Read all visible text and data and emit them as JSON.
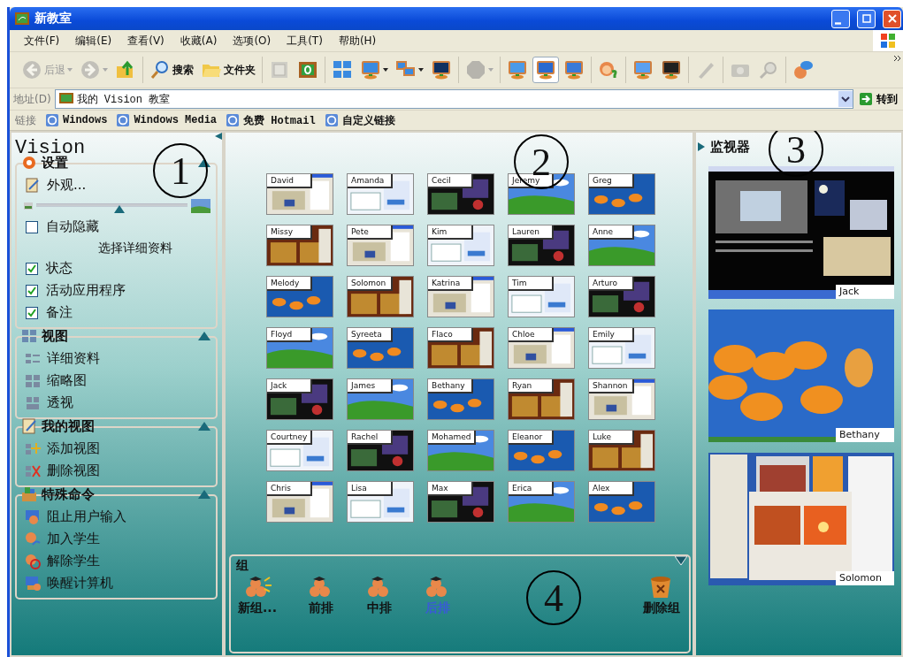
{
  "window": {
    "title": "新教室"
  },
  "menu": [
    {
      "label": "文件(F)"
    },
    {
      "label": "编辑(E)"
    },
    {
      "label": "查看(V)"
    },
    {
      "label": "收藏(A)"
    },
    {
      "label": "选项(O)"
    },
    {
      "label": "工具(T)"
    },
    {
      "label": "帮助(H)"
    }
  ],
  "toolbar": [
    {
      "kind": "button",
      "label": "后退",
      "disabled": true,
      "dropdown": true,
      "selected": false
    },
    {
      "kind": "button",
      "disabled": true,
      "dropdown": true,
      "selected": false
    },
    {
      "kind": "button",
      "disabled": false,
      "dropdown": false,
      "selected": false
    },
    {
      "kind": "separator"
    },
    {
      "kind": "button",
      "label": "搜索",
      "disabled": false,
      "dropdown": false,
      "selected": false
    },
    {
      "kind": "button",
      "label": "文件夹",
      "disabled": false,
      "dropdown": false,
      "selected": false
    },
    {
      "kind": "separator"
    },
    {
      "kind": "button",
      "disabled": true,
      "dropdown": false,
      "selected": false
    },
    {
      "kind": "button",
      "disabled": false,
      "dropdown": false,
      "selected": false
    },
    {
      "kind": "separator"
    },
    {
      "kind": "button",
      "disabled": false,
      "dropdown": false,
      "selected": false
    },
    {
      "kind": "button",
      "disabled": false,
      "dropdown": true,
      "selected": false
    },
    {
      "kind": "button",
      "disabled": false,
      "dropdown": true,
      "selected": false
    },
    {
      "kind": "button",
      "disabled": false,
      "dropdown": false,
      "selected": false
    },
    {
      "kind": "separator"
    },
    {
      "kind": "button",
      "disabled": true,
      "dropdown": true,
      "selected": false
    },
    {
      "kind": "separator"
    },
    {
      "kind": "button",
      "disabled": false,
      "dropdown": false,
      "selected": false
    },
    {
      "kind": "button",
      "disabled": false,
      "dropdown": false,
      "selected": true
    },
    {
      "kind": "button",
      "disabled": false,
      "dropdown": false,
      "selected": false
    },
    {
      "kind": "separator"
    },
    {
      "kind": "button",
      "disabled": false,
      "dropdown": false,
      "selected": false
    },
    {
      "kind": "separator"
    },
    {
      "kind": "button",
      "disabled": false,
      "dropdown": false,
      "selected": false
    },
    {
      "kind": "button",
      "disabled": false,
      "dropdown": false,
      "selected": false
    },
    {
      "kind": "separator"
    },
    {
      "kind": "button",
      "disabled": true,
      "dropdown": false,
      "selected": false
    },
    {
      "kind": "separator"
    },
    {
      "kind": "button",
      "disabled": true,
      "dropdown": false,
      "selected": false
    },
    {
      "kind": "button",
      "disabled": true,
      "dropdown": false,
      "selected": false
    },
    {
      "kind": "separator"
    },
    {
      "kind": "button",
      "disabled": false,
      "dropdown": false,
      "selected": false
    }
  ],
  "address": {
    "label": "地址(D)",
    "value": "我的 Vision 教室",
    "go": "转到"
  },
  "links": {
    "label": "链接",
    "items": [
      {
        "label": "Windows"
      },
      {
        "label": "Windows Media"
      },
      {
        "label": "免费 Hotmail"
      },
      {
        "label": "自定义链接"
      }
    ]
  },
  "sidebar": {
    "title": "Vision",
    "callout": "1",
    "sections": [
      {
        "title": "设置",
        "items": [
          {
            "kind": "link",
            "label": "外观..."
          },
          {
            "kind": "slider",
            "level": 0.55
          },
          {
            "kind": "checkbox",
            "label": "自动隐藏",
            "checked": false
          },
          {
            "kind": "heading",
            "label": "选择详细资料"
          },
          {
            "kind": "checkbox",
            "label": "状态",
            "checked": true
          },
          {
            "kind": "checkbox",
            "label": "活动应用程序",
            "checked": true
          },
          {
            "kind": "checkbox",
            "label": "备注",
            "checked": true
          }
        ]
      },
      {
        "title": "视图",
        "items": [
          {
            "kind": "link",
            "label": "详细资料"
          },
          {
            "kind": "link",
            "label": "缩略图"
          },
          {
            "kind": "link",
            "label": "透视"
          }
        ]
      },
      {
        "title": "我的视图",
        "items": [
          {
            "kind": "link",
            "label": "添加视图"
          },
          {
            "kind": "link",
            "label": "删除视图"
          }
        ]
      },
      {
        "title": "特殊命令",
        "items": [
          {
            "kind": "link",
            "label": "阻止用户输入"
          },
          {
            "kind": "link",
            "label": "加入学生"
          },
          {
            "kind": "link",
            "label": "解除学生"
          },
          {
            "kind": "link",
            "label": "唤醒计算机"
          }
        ]
      }
    ]
  },
  "classroom": {
    "callout": "2",
    "students": [
      {
        "name": "David"
      },
      {
        "name": "Amanda"
      },
      {
        "name": "Cecil"
      },
      {
        "name": "Jeremy"
      },
      {
        "name": "Greg"
      },
      {
        "name": "Missy"
      },
      {
        "name": "Pete"
      },
      {
        "name": "Kim"
      },
      {
        "name": "Lauren"
      },
      {
        "name": "Anne"
      },
      {
        "name": "Melody"
      },
      {
        "name": "Solomon"
      },
      {
        "name": "Katrina"
      },
      {
        "name": "Tim"
      },
      {
        "name": "Arturo"
      },
      {
        "name": "Floyd"
      },
      {
        "name": "Syreeta"
      },
      {
        "name": "Flaco"
      },
      {
        "name": "Chloe"
      },
      {
        "name": "Emily"
      },
      {
        "name": "Jack"
      },
      {
        "name": "James"
      },
      {
        "name": "Bethany"
      },
      {
        "name": "Ryan"
      },
      {
        "name": "Shannon"
      },
      {
        "name": "Courtney"
      },
      {
        "name": "Rachel"
      },
      {
        "name": "Mohamed"
      },
      {
        "name": "Eleanor"
      },
      {
        "name": "Luke"
      },
      {
        "name": "Chris"
      },
      {
        "name": "Lisa"
      },
      {
        "name": "Max"
      },
      {
        "name": "Erica"
      },
      {
        "name": "Alex"
      }
    ]
  },
  "groups": {
    "title": "组",
    "callout": "4",
    "items": [
      {
        "kind": "new",
        "label": "新组...",
        "selected": false
      },
      {
        "kind": "group",
        "label": "前排",
        "selected": false
      },
      {
        "kind": "group",
        "label": "中排",
        "selected": false
      },
      {
        "kind": "group",
        "label": "后排",
        "selected": true
      },
      {
        "kind": "delete",
        "label": "删除组",
        "selected": false
      }
    ]
  },
  "monitor": {
    "title": "监视器",
    "callout": "3",
    "screens": [
      {
        "name": "Jack"
      },
      {
        "name": "Bethany"
      },
      {
        "name": "Solomon"
      }
    ]
  }
}
